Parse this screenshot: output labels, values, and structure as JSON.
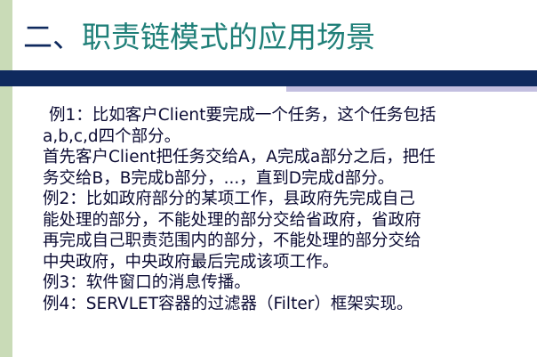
{
  "slide": {
    "title_prefix": "二、",
    "title_main": "职责链模式的应用场景",
    "lines": [
      "例1：比如客户Client要完成一个任务，这个任务包括",
      "a,b,c,d四个部分。",
      "首先客户Client把任务交给A，A完成a部分之后，把任",
      "务交给B，B完成b部分，...，直到D完成d部分。",
      "例2：比如政府部分的某项工作，县政府先完成自己",
      "能处理的部分，不能处理的部分交给省政府，省政府",
      "再完成自己职责范围内的部分，不能处理的部分交给",
      "中央政府，中央政府最后完成该项工作。",
      "例3：软件窗口的消息传播。",
      "例4：SERVLET容器的过滤器（Filter）框架实现。"
    ]
  },
  "colors": {
    "title_prefix": "#0f2a5e",
    "title_main": "#1f7f78",
    "navy_bar": "#0f2a5e",
    "lavender_bar": "#c3bfe0",
    "left_stripe": "#c9dbb7",
    "body_text": "#0b0b33"
  }
}
